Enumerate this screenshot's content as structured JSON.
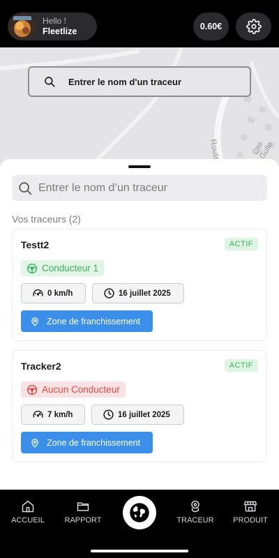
{
  "header": {
    "greeting": "Hello !",
    "username": "Fleetlize",
    "balance": "0.60€"
  },
  "map": {
    "search_label": "Entrer le nom d'un traceur",
    "street_labels": [
      "Route",
      "Cité Gulle"
    ]
  },
  "sheet": {
    "search_placeholder": "Entrer le nom d’un traceur",
    "section_title": "Vos traceurs (2)"
  },
  "trackers": [
    {
      "name": "Testt2",
      "status": "ACTIF",
      "driver": "Conducteur 1",
      "driver_state": "assigned",
      "speed": "0 km/h",
      "date": "16 juillet 2025",
      "zone_button": "Zone de franchissement"
    },
    {
      "name": "Tracker2",
      "status": "ACTIF",
      "driver": "Aucun Conducteur",
      "driver_state": "none",
      "speed": "7 km/h",
      "date": "16 juillet 2025",
      "zone_button": "Zone de franchissement"
    }
  ],
  "nav": {
    "items": [
      {
        "label": "ACCUEIL",
        "icon": "home-icon"
      },
      {
        "label": "RAPPORT",
        "icon": "folder-icon"
      },
      {
        "label": "",
        "icon": "globe-icon"
      },
      {
        "label": "TRACEUR",
        "icon": "tracker-icon"
      },
      {
        "label": "PRODUIT",
        "icon": "store-icon"
      }
    ]
  },
  "colors": {
    "accent_blue": "#3b8fe8",
    "active_green": "#3ab25a",
    "danger_red": "#e04848"
  }
}
